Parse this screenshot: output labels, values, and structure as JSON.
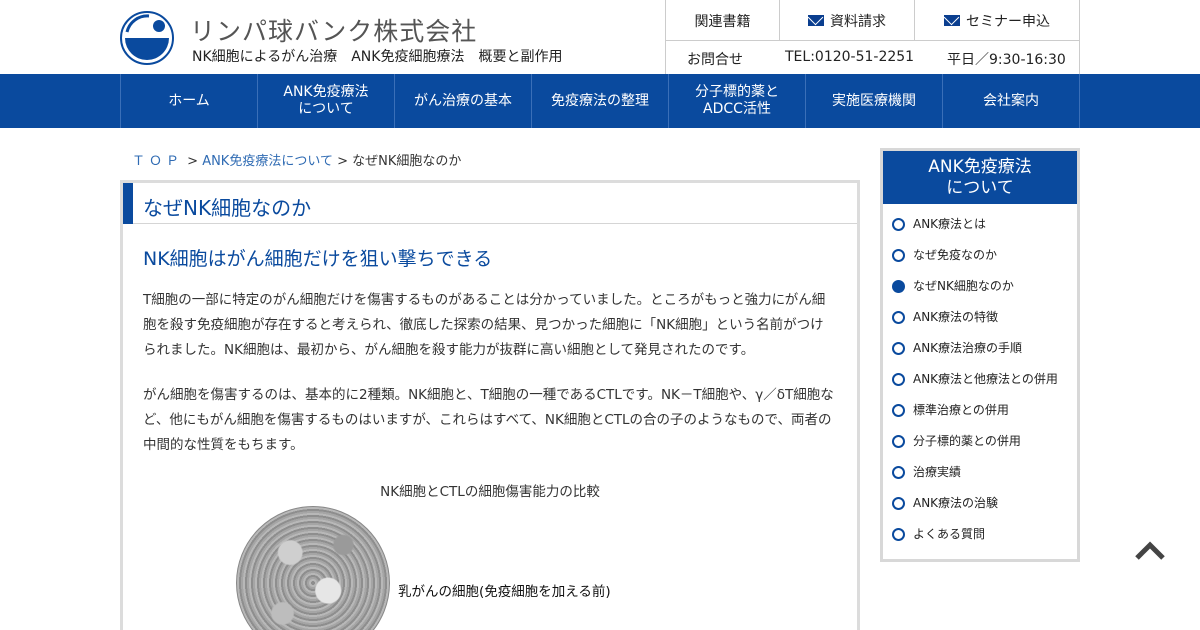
{
  "header": {
    "company_name": "リンパ球バンク株式会社",
    "tagline": "NK細胞によるがん治療　ANK免疫細胞療法　概要と副作用",
    "util_links": [
      {
        "label": "関連書籍",
        "icon": ""
      },
      {
        "label": "資料請求",
        "icon": "mail-icon"
      },
      {
        "label": "セミナー申込",
        "icon": "mail-icon"
      }
    ],
    "contact_label": "お問合せ",
    "tel": "TEL:0120-51-2251",
    "hours": "平日／9:30-16:30"
  },
  "nav": {
    "items": [
      {
        "label": "ホーム"
      },
      {
        "label": "ANK免疫療法\nについて"
      },
      {
        "label": "がん治療の基本"
      },
      {
        "label": "免疫療法の整理"
      },
      {
        "label": "分子標的薬と\nADCC活性"
      },
      {
        "label": "実施医療機関"
      },
      {
        "label": "会社案内"
      }
    ]
  },
  "breadcrumb": {
    "top": "ＴＯＰ",
    "sep": " > ",
    "parent": "ANK免疫療法について",
    "current": "なぜNK細胞なのか"
  },
  "main": {
    "title": "なぜNK細胞なのか",
    "subhead": "NK細胞はがん細胞だけを狙い撃ちできる",
    "para1": "T細胞の一部に特定のがん細胞だけを傷害するものがあることは分かっていました。ところがもっと強力にがん細胞を殺す免疫細胞が存在すると考えられ、徹底した探索の結果、見つかった細胞に「NK細胞」という名前がつけられました。NK細胞は、最初から、がん細胞を殺す能力が抜群に高い細胞として発見されたのです。",
    "para2": "がん細胞を傷害するのは、基本的に2種類。NK細胞と、T細胞の一種であるCTLです。NK－T細胞や、γ／δT細胞など、他にもがん細胞を傷害するものはいますが、これらはすべて、NK細胞とCTLの合の子のようなもので、両者の中間的な性質をもちます。",
    "figure_caption": "NK細胞とCTLの細胞傷害能力の比較",
    "image_label": "乳がんの細胞(免疫細胞を加える前)"
  },
  "sidebar": {
    "heading": "ANK免疫療法\nについて",
    "items": [
      {
        "label": "ANK療法とは",
        "active": false
      },
      {
        "label": "なぜ免疫なのか",
        "active": false
      },
      {
        "label": "なぜNK細胞なのか",
        "active": true
      },
      {
        "label": "ANK療法の特徴",
        "active": false
      },
      {
        "label": "ANK療法治療の手順",
        "active": false
      },
      {
        "label": "ANK療法と他療法との併用",
        "active": false
      },
      {
        "label": "標準治療との併用",
        "active": false
      },
      {
        "label": "分子標的薬との併用",
        "active": false
      },
      {
        "label": "治療実績",
        "active": false
      },
      {
        "label": "ANK療法の治験",
        "active": false
      },
      {
        "label": "よくある質問",
        "active": false
      }
    ]
  },
  "colors": {
    "brand_blue": "#0a4a9e",
    "link_blue": "#2f6bb3"
  }
}
